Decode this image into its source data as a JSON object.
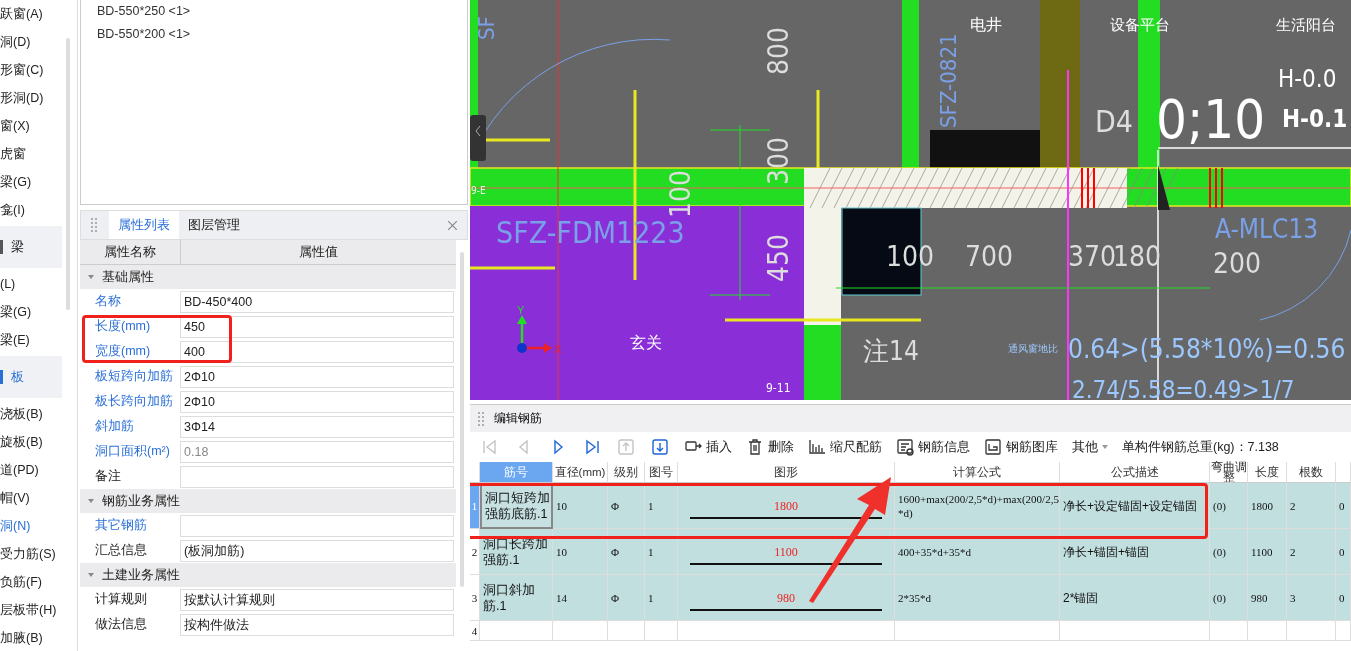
{
  "sidebar": {
    "items": [
      {
        "label": "跃窗(A)",
        "kind": "item",
        "selected": false
      },
      {
        "label": "洞(D)",
        "kind": "item",
        "selected": false
      },
      {
        "label": "形窗(C)",
        "kind": "item",
        "selected": false
      },
      {
        "label": "形洞(D)",
        "kind": "item",
        "selected": false
      },
      {
        "label": "窗(X)",
        "kind": "item",
        "selected": false
      },
      {
        "label": "虎窗",
        "kind": "item",
        "selected": false
      },
      {
        "label": "梁(G)",
        "kind": "item",
        "selected": false
      },
      {
        "label": "龛(I)",
        "kind": "item",
        "selected": false
      },
      {
        "label": "梁",
        "kind": "group",
        "selected": false
      },
      {
        "label": "(L)",
        "kind": "item",
        "selected": false
      },
      {
        "label": "梁(G)",
        "kind": "item",
        "selected": false
      },
      {
        "label": "梁(E)",
        "kind": "item",
        "selected": false
      },
      {
        "label": "板",
        "kind": "group",
        "selected": true
      },
      {
        "label": "浇板(B)",
        "kind": "item",
        "selected": false
      },
      {
        "label": "旋板(B)",
        "kind": "item",
        "selected": false
      },
      {
        "label": "道(PD)",
        "kind": "item",
        "selected": false
      },
      {
        "label": "帽(V)",
        "kind": "item",
        "selected": false
      },
      {
        "label": "洞(N)",
        "kind": "item",
        "selected": true
      },
      {
        "label": "受力筋(S)",
        "kind": "item",
        "selected": false
      },
      {
        "label": "负筋(F)",
        "kind": "item",
        "selected": false
      },
      {
        "label": "层板带(H)",
        "kind": "item",
        "selected": false
      },
      {
        "label": "加腋(B)",
        "kind": "item",
        "selected": false
      }
    ]
  },
  "component_list": {
    "items": [
      "BD-550*250 <1>",
      "BD-550*200 <1>"
    ]
  },
  "property_panel": {
    "tabs": [
      {
        "label": "属性列表",
        "selected": true
      },
      {
        "label": "图层管理",
        "selected": false
      }
    ],
    "columns": [
      "属性名称",
      "属性值"
    ],
    "sections": [
      {
        "title": "基础属性",
        "expanded": true,
        "rows": [
          {
            "name": "名称",
            "value": "BD-450*400",
            "public": true,
            "disabled": false
          },
          {
            "name": "长度(mm)",
            "value": "450",
            "public": true,
            "disabled": false
          },
          {
            "name": "宽度(mm)",
            "value": "400",
            "public": true,
            "disabled": false
          },
          {
            "name": "板短跨向加筋",
            "value": "2Φ10",
            "public": true,
            "disabled": false
          },
          {
            "name": "板长跨向加筋",
            "value": "2Φ10",
            "public": true,
            "disabled": false
          },
          {
            "name": "斜加筋",
            "value": "3Φ14",
            "public": true,
            "disabled": false
          },
          {
            "name": "洞口面积(m²)",
            "value": "0.18",
            "public": true,
            "disabled": true
          },
          {
            "name": "备注",
            "value": "",
            "public": false,
            "disabled": false
          }
        ]
      },
      {
        "title": "钢筋业务属性",
        "expanded": true,
        "rows": [
          {
            "name": "其它钢筋",
            "value": "",
            "public": true,
            "disabled": false
          },
          {
            "name": "汇总信息",
            "value": "(板洞加筋)",
            "public": false,
            "disabled": false
          }
        ]
      },
      {
        "title": "土建业务属性",
        "expanded": true,
        "rows": [
          {
            "name": "计算规则",
            "value": "按默认计算规则",
            "public": false,
            "disabled": false
          },
          {
            "name": "做法信息",
            "value": "按构件做法",
            "public": false,
            "disabled": false
          }
        ]
      }
    ]
  },
  "cad_view": {
    "labels": [
      "SF",
      "800",
      "300",
      "100",
      "450",
      "SFZ-0821",
      "电井",
      "设备平台",
      "生活阳台",
      "H-0.0",
      "D4",
      "0;10",
      "H-0.1",
      "9-E",
      "SFZ-FDM1223",
      "100",
      "700",
      "370",
      "180",
      "A-MLC13",
      "200",
      "玄关",
      "注14",
      "9-11",
      "通风窗地比",
      "0.64>(5.58*10%)=0.56",
      "2.74/5.58=0.49>1/7"
    ],
    "axis_labels": [
      "Y",
      "X"
    ]
  },
  "rebar_editor": {
    "title": "编辑钢筋",
    "nav": [
      {
        "kind": "first",
        "disabled": true
      },
      {
        "kind": "prev",
        "disabled": true
      },
      {
        "kind": "next",
        "disabled": false
      },
      {
        "kind": "last",
        "disabled": false
      },
      {
        "kind": "up",
        "disabled": true
      },
      {
        "kind": "down",
        "disabled": false
      }
    ],
    "tools": [
      {
        "kind": "insert",
        "label": "插入"
      },
      {
        "kind": "delete",
        "label": "删除"
      },
      {
        "kind": "scale",
        "label": "缩尺配筋"
      },
      {
        "kind": "info",
        "label": "钢筋信息"
      },
      {
        "kind": "library",
        "label": "钢筋图库"
      },
      {
        "kind": "more",
        "label": "其他"
      }
    ],
    "total_weight": "单构件钢筋总重(kg)：7.138",
    "table": {
      "columns": [
        "筋号",
        "直径(mm)",
        "级别",
        "图号",
        "图形",
        "计算公式",
        "公式描述",
        "弯曲调整",
        "长度",
        "根数"
      ],
      "rows": [
        {
          "number": "1",
          "selected": true,
          "name": "洞口短跨加强筋底筋.1",
          "diameter": "10",
          "grade": "Φ",
          "figure_no": "1",
          "shape": "1800",
          "formula": "1600+max(200/2,5*d)+max(200/2,5*d)",
          "description": "净长+设定锚固+设定锚固",
          "bend": "(0)",
          "length": "1800",
          "count": "2",
          "column_11": "0"
        },
        {
          "number": "2",
          "selected": false,
          "name": "洞口长跨加强筋.1",
          "diameter": "10",
          "grade": "Φ",
          "figure_no": "1",
          "shape": "1100",
          "formula": "400+35*d+35*d",
          "description": "净长+锚固+锚固",
          "bend": "(0)",
          "length": "1100",
          "count": "2",
          "column_11": "0"
        },
        {
          "number": "3",
          "selected": false,
          "name": "洞口斜加筋.1",
          "diameter": "14",
          "grade": "Φ",
          "figure_no": "1",
          "shape": "980",
          "formula": "2*35*d",
          "description": "2*锚固",
          "bend": "(0)",
          "length": "980",
          "count": "3",
          "column_11": "0"
        },
        {
          "number": "4",
          "selected": false
        }
      ]
    }
  }
}
